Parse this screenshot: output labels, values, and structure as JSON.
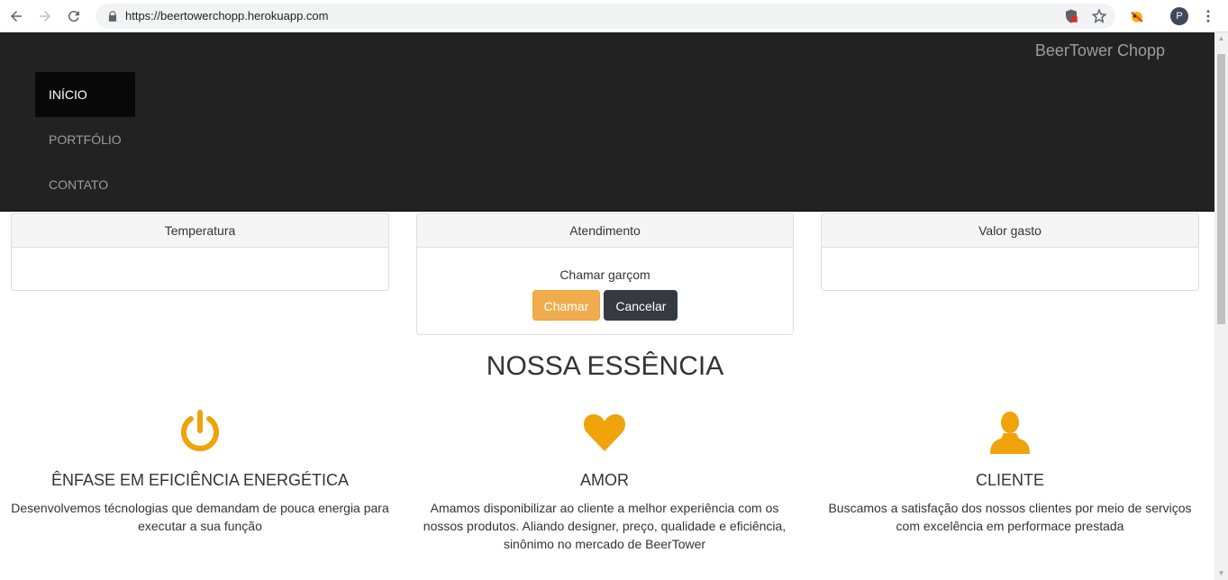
{
  "browser": {
    "url": "https://beertowerchopp.herokuapp.com",
    "profile_initial": "P"
  },
  "navbar": {
    "brand": "BeerTower Chopp",
    "items": [
      {
        "label": "INÍCIO",
        "active": true
      },
      {
        "label": "PORTFÓLIO",
        "active": false
      },
      {
        "label": "CONTATO",
        "active": false
      }
    ]
  },
  "cards": {
    "temperature": {
      "title": "Temperatura"
    },
    "service": {
      "title": "Atendimento",
      "call_label": "Chamar garçom",
      "call_button": "Chamar",
      "cancel_button": "Cancelar"
    },
    "spent": {
      "title": "Valor gasto"
    }
  },
  "essence": {
    "title": "NOSSA ESSÊNCIA",
    "features": [
      {
        "icon": "power-icon",
        "title": "ÊNFASE EM EFICIÊNCIA ENERGÉTICA",
        "text": "Desenvolvemos técnologias que demandam de pouca energia para executar a sua função"
      },
      {
        "icon": "heart-icon",
        "title": "AMOR",
        "text": "Amamos disponibilizar ao cliente a melhor experiência com os nossos produtos. Aliando designer, preço, qualidade e eficiência, sinônimo no mercado de BeerTower"
      },
      {
        "icon": "user-icon",
        "title": "CLIENTE",
        "text": "Buscamos a satisfação dos nossos clientes por meio de serviços com excelência em performace prestada"
      }
    ]
  },
  "colors": {
    "accent": "#f0a30a",
    "navbar_bg": "#222222",
    "warning_button": "#f0ad4e",
    "dark_button": "#343a40"
  }
}
